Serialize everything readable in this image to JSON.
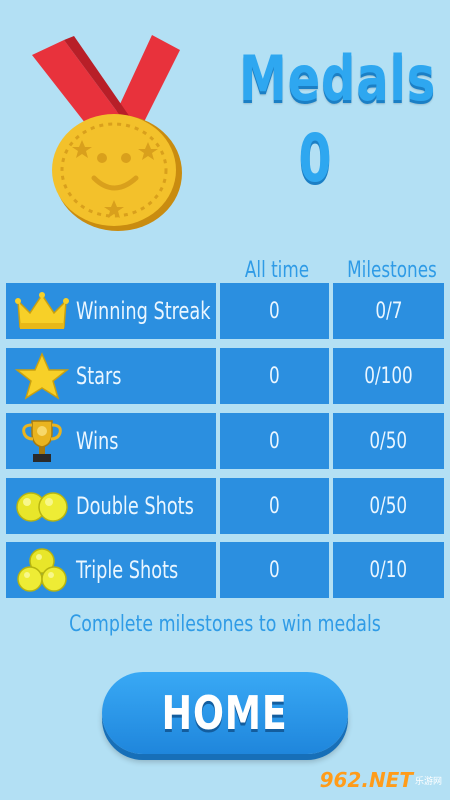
{
  "header": {
    "title": "Medals",
    "count": "0"
  },
  "columns": {
    "all_time": "All time",
    "milestones": "Milestones"
  },
  "rows": [
    {
      "label": "Winning Streak",
      "all_time": "0",
      "milestones": "0/7",
      "icon": "crown-icon"
    },
    {
      "label": "Stars",
      "all_time": "0",
      "milestones": "0/100",
      "icon": "star-icon"
    },
    {
      "label": "Wins",
      "all_time": "0",
      "milestones": "0/50",
      "icon": "trophy-icon"
    },
    {
      "label": "Double Shots",
      "all_time": "0",
      "milestones": "0/50",
      "icon": "double-balls-icon"
    },
    {
      "label": "Triple Shots",
      "all_time": "0",
      "milestones": "0/10",
      "icon": "triple-balls-icon"
    }
  ],
  "hint": "Complete milestones to win medals",
  "home_button": "HOME",
  "watermark": {
    "text": "962.NET",
    "sub": "乐游网"
  },
  "colors": {
    "background": "#b3e0f4",
    "accent": "#2ea7f0",
    "cell": "#2b8fe0",
    "gold": "#f3c12b",
    "ribbon": "#e33039"
  }
}
